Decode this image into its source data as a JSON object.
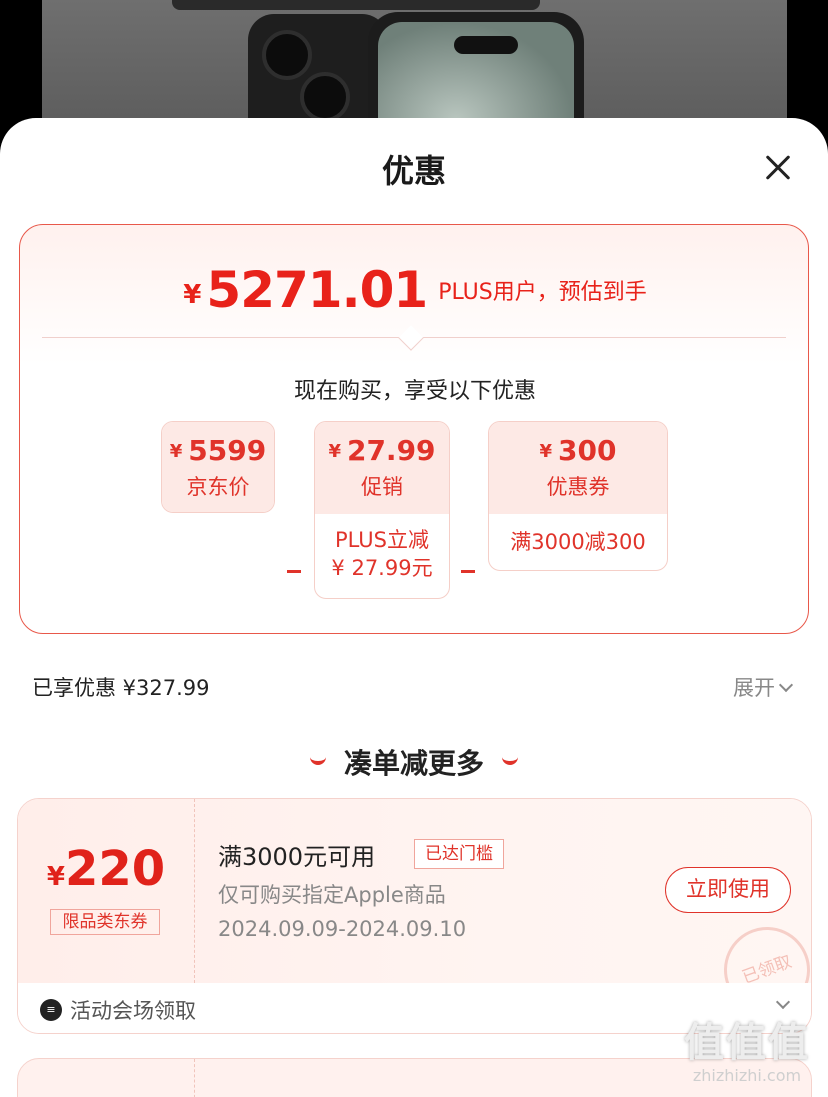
{
  "sheet": {
    "title": "优惠"
  },
  "estimate": {
    "currency": "¥",
    "price": "5271.01",
    "tag": "PLUS用户，预估到手",
    "intro": "现在购买，享受以下优惠",
    "breakdown": [
      {
        "symbol": "¥",
        "value": "5599",
        "label": "京东价"
      },
      {
        "symbol": "¥",
        "value": "27.99",
        "label": "促销",
        "sub": [
          "PLUS立减",
          "¥ 27.99元"
        ]
      },
      {
        "symbol": "¥",
        "value": "300",
        "label": "优惠券",
        "sub": [
          "满3000减300"
        ]
      }
    ],
    "operators": [
      "-",
      "-"
    ]
  },
  "summary": {
    "label": "已享优惠 ¥327.99",
    "expand": "展开"
  },
  "more": {
    "title": "凑单减更多"
  },
  "coupon": {
    "symbol": "¥",
    "amount": "220",
    "type": "限品类东券",
    "condition": "满3000元可用",
    "reached": "已达门槛",
    "scope": "仅可购买指定Apple商品",
    "date": "2024.09.09-2024.09.10",
    "button": "立即使用",
    "stamp": "已领取",
    "foot_text": "活动会场领取"
  },
  "colors": {
    "accent": "#e0332a",
    "price": "#e8221a",
    "card_border": "#e8584a"
  },
  "watermark": {
    "logo": "值值值",
    "url": "zhizhizhi.com"
  }
}
